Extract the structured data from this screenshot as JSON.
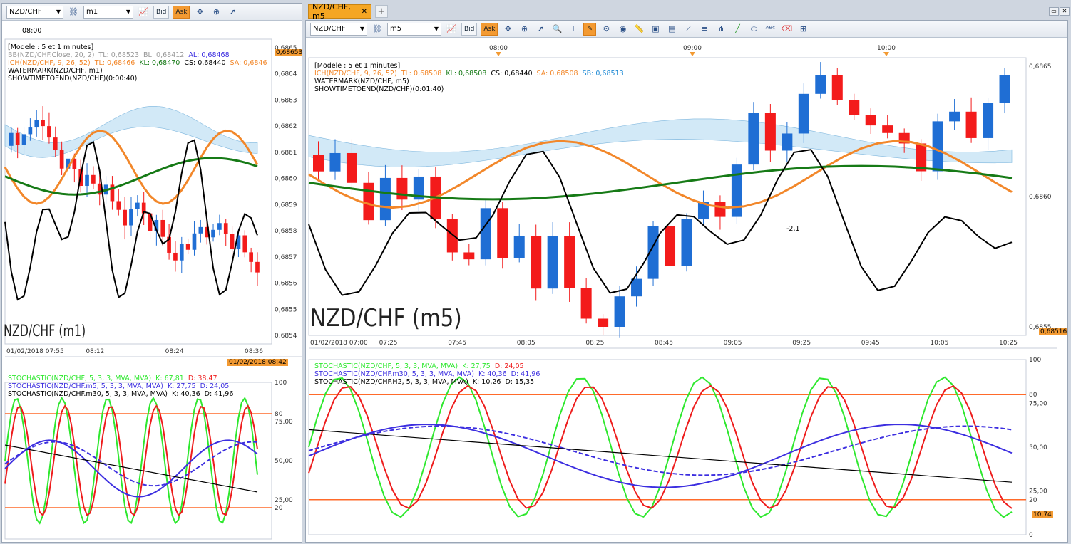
{
  "left": {
    "toolbar": {
      "symbol": "NZD/CHF",
      "timeframe": "m1",
      "bid": "Bid",
      "ask": "Ask"
    },
    "top_time": "08:00",
    "info": {
      "model": "[Modele : 5 et 1 minutes]",
      "bb": {
        "name": "BB(NZD/CHF.Close, 20, 2)",
        "tl": "TL: 0,68523",
        "bl": "BL: 0,68412",
        "al": "AL: 0,68468"
      },
      "ich": {
        "name": "ICH(NZD/CHF, 9, 26, 52)",
        "tl": "TL: 0,68466",
        "kl": "KL: 0,68470",
        "cs": "CS: 0,68440",
        "sa": "SA: 0,6846"
      },
      "watermark": "WATERMARK(NZD/CHF, m1)",
      "showtime": "SHOWTIMETOEND(NZD/CHF)(0:00:40)"
    },
    "watermark_text": "NZD/CHF (m1)",
    "price_tag": "0,68653",
    "price_ticks": [
      "0,6865",
      "0,6864",
      "0,6863",
      "0,6862",
      "0,6861",
      "0,6860",
      "0,6859",
      "0,6858",
      "0,6857",
      "0,6856",
      "0,6855",
      "0,6854"
    ],
    "time_ticks": [
      "01/02/2018 07:55",
      "08:12",
      "08:24",
      "08:36"
    ],
    "time_tag": "01/02/2018 08:42",
    "stoch": {
      "l1": {
        "name": "STOCHASTIC(NZD/CHF, 5, 3, 3, MVA, MVA)",
        "k": "K: 67,81",
        "d": "D: 38,47"
      },
      "l2": {
        "name": "STOCHASTIC(NZD/CHF.m5, 5, 3, 3, MVA, MVA)",
        "k": "K: 27,75",
        "d": "D: 24,05"
      },
      "l3": {
        "name": "STOCHASTIC(NZD/CHF.m30, 5, 3, 3, MVA, MVA)",
        "k": "K: 40,36",
        "d": "D: 41,96"
      }
    },
    "stoch_ticks": [
      "100",
      "80",
      "75,00",
      "50,00",
      "25,00",
      "20"
    ]
  },
  "right": {
    "tab": "NZD/CHF, m5",
    "toolbar": {
      "symbol": "NZD/CHF",
      "timeframe": "m5",
      "bid": "Bid",
      "ask": "Ask"
    },
    "top_times": [
      "08:00",
      "09:00",
      "10:00"
    ],
    "info": {
      "model": "[Modele : 5 et 1 minutes]",
      "ich": {
        "name": "ICH(NZD/CHF, 9, 26, 52)",
        "tl": "TL: 0,68508",
        "kl": "KL: 0,68508",
        "cs": "CS: 0,68440",
        "sa": "SA: 0,68508",
        "sb": "SB: 0,68513"
      },
      "watermark": "WATERMARK(NZD/CHF, m5)",
      "showtime": "SHOWTIMETOEND(NZD/CHF)(0:01:40)"
    },
    "watermark_text": "NZD/CHF (m5)",
    "signal_label": "-2,1",
    "price_ticks": [
      "0,6865",
      "0,6860",
      "0,6855"
    ],
    "price_tag": "0,68516",
    "time_ticks": [
      "01/02/2018 07:00",
      "07:25",
      "07:45",
      "08:05",
      "08:25",
      "08:45",
      "09:05",
      "09:25",
      "09:45",
      "10:05",
      "10:25"
    ],
    "stoch": {
      "l1": {
        "name": "STOCHASTIC(NZD/CHF, 5, 3, 3, MVA, MVA)",
        "k": "K: 27,75",
        "d": "D: 24,05"
      },
      "l2": {
        "name": "STOCHASTIC(NZD/CHF.m30, 5, 3, 3, MVA, MVA)",
        "k": "K: 40,36",
        "d": "D: 41,96"
      },
      "l3": {
        "name": "STOCHASTIC(NZD/CHF.H2, 5, 3, 3, MVA, MVA)",
        "k": "K: 10,26",
        "d": "D: 15,35"
      }
    },
    "stoch_ticks": [
      "100",
      "80",
      "75,00",
      "50,00",
      "25,00",
      "20",
      "0"
    ],
    "stoch_tag": "10,74"
  },
  "colors": {
    "bull": "#1f6ed4",
    "bear": "#f31b1b",
    "tenkan": "#f2872a",
    "kijun": "#167a16",
    "chikou": "#000000",
    "cloud_bull": "#bfe0f3",
    "cloud_bear": "#fbe1cc",
    "stoch_k": "#2ee82e",
    "stoch_d": "#ee1c1c",
    "stoch_m30": "#3c2ee0",
    "level": "#ff6a2a"
  },
  "icons": [
    "link-icon",
    "chart-type-icon",
    "crosshair-icon",
    "zoom-icon",
    "drawing-icon",
    "ruler-icon",
    "palette-icon",
    "globe-icon",
    "eraser-icon"
  ]
}
